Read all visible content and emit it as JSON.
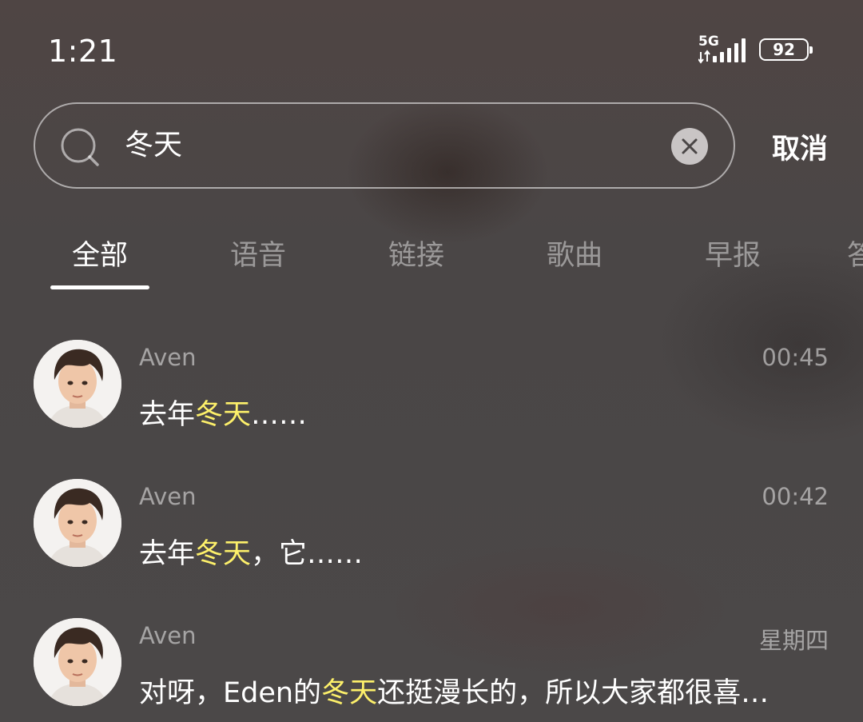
{
  "status_bar": {
    "time": "1:21",
    "network": "5G",
    "battery": "92"
  },
  "search": {
    "query": "冬天",
    "cancel_label": "取消"
  },
  "tabs": [
    {
      "label": "全部",
      "active": true
    },
    {
      "label": "语音",
      "active": false
    },
    {
      "label": "链接",
      "active": false
    },
    {
      "label": "歌曲",
      "active": false
    },
    {
      "label": "早报",
      "active": false
    },
    {
      "label": "答",
      "active": false
    }
  ],
  "results": [
    {
      "name": "Aven",
      "time": "00:45",
      "text_before": "去年",
      "highlight": "冬天",
      "text_after": "……"
    },
    {
      "name": "Aven",
      "time": "00:42",
      "text_before": "去年",
      "highlight": "冬天",
      "text_after": "，它……"
    },
    {
      "name": "Aven",
      "time": "星期四",
      "text_before": "对呀，Eden的",
      "highlight": "冬天",
      "text_after": "还挺漫长的，所以大家都很喜…"
    }
  ],
  "colors": {
    "highlight": "#fdf06a",
    "background": "#4a4646"
  }
}
